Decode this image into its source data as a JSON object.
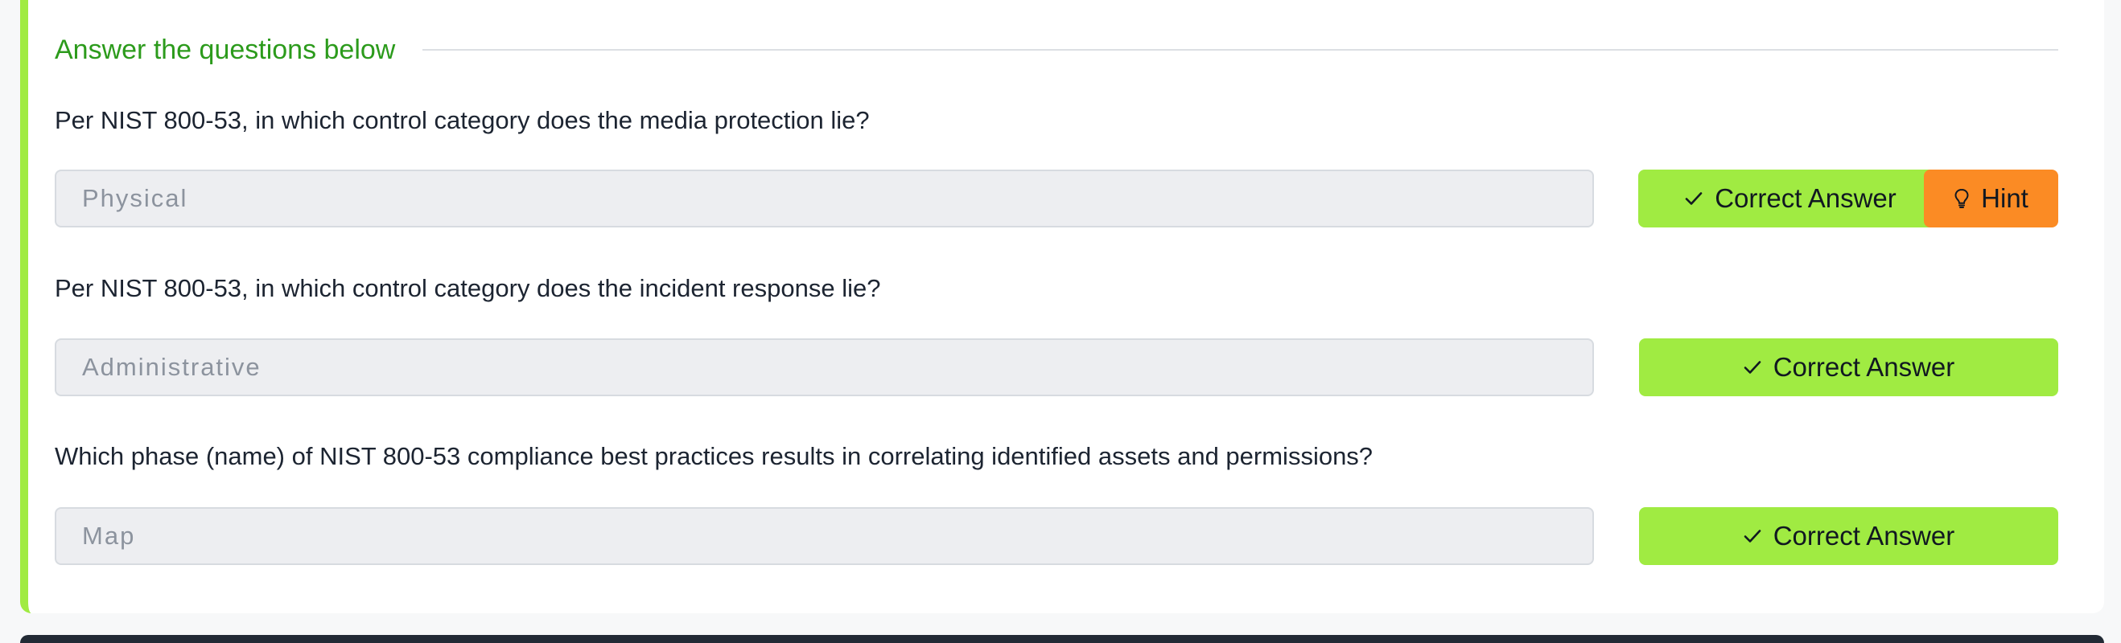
{
  "section": {
    "title": "Answer the questions below"
  },
  "questions": [
    {
      "text": "Per NIST 800-53, in which control category does the media protection lie?",
      "answer": "Physical",
      "button_label": "Correct Answer",
      "hint_label": "Hint"
    },
    {
      "text": "Per NIST 800-53, in which control category does the incident response lie?",
      "answer": "Administrative",
      "button_label": "Correct Answer"
    },
    {
      "text": "Which phase (name) of NIST 800-53 compliance best practices results in correlating identified assets and permissions?",
      "answer": "Map",
      "button_label": "Correct Answer"
    }
  ],
  "icons": {
    "correct": "checkmark-icon",
    "hint": "lightbulb-icon"
  },
  "colors": {
    "accent_green": "#a0eb42",
    "title_green": "#2c9b1c",
    "hint_orange": "#fb8b24",
    "field_bg": "#edeef1"
  }
}
